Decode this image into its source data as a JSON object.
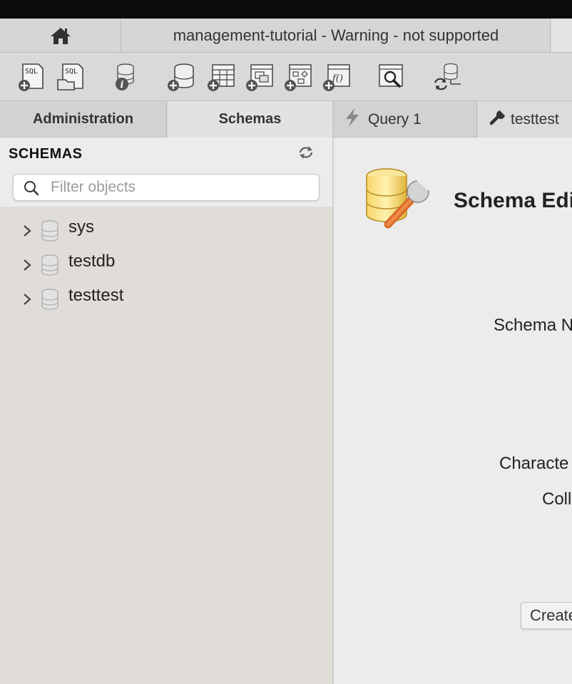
{
  "window": {
    "title": "management-tutorial - Warning - not supported"
  },
  "sidebar": {
    "tabs": [
      {
        "label": "Administration"
      },
      {
        "label": "Schemas"
      }
    ],
    "header": "SCHEMAS",
    "filter": {
      "placeholder": "Filter objects",
      "value": ""
    },
    "schemas": [
      {
        "name": "sys"
      },
      {
        "name": "testdb"
      },
      {
        "name": "testtest"
      }
    ]
  },
  "editor_tabs": [
    {
      "label": "Query 1",
      "icon": "lightning-icon"
    },
    {
      "label": "testtest",
      "icon": "wrench-icon"
    }
  ],
  "editor": {
    "title": "Schema Edi",
    "schema_name_label": "Schema N",
    "charset_label": "Characte",
    "collation_label": "Coll",
    "create_button": "Create"
  },
  "colors": {
    "sidebar_bg": "#e0dcd7",
    "tabbar_bg": "#d6d6d6",
    "toolbar_bg": "#d9d9d9",
    "content_bg": "#ececec"
  }
}
